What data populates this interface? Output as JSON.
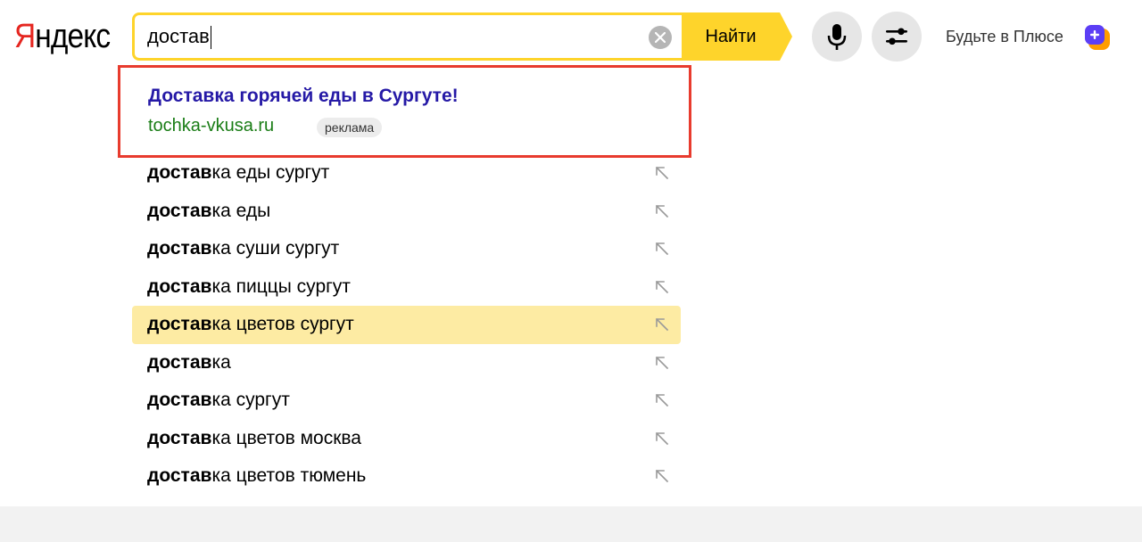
{
  "header": {
    "logo_first": "Я",
    "logo_rest": "ндекс",
    "find_label": "Найти",
    "plus_label": "Будьте в Плюсе"
  },
  "search": {
    "value": "достав"
  },
  "ad": {
    "title": "Доставка горячей еды в Сургуте!",
    "url": "tochka-vkusa.ru",
    "badge": "реклама"
  },
  "suggestions": [
    {
      "bold": "достав",
      "rest": "ка еды сургут",
      "highlighted": false
    },
    {
      "bold": "достав",
      "rest": "ка еды",
      "highlighted": false
    },
    {
      "bold": "достав",
      "rest": "ка суши сургут",
      "highlighted": false
    },
    {
      "bold": "достав",
      "rest": "ка пиццы сургут",
      "highlighted": false
    },
    {
      "bold": "достав",
      "rest": "ка цветов сургут",
      "highlighted": true
    },
    {
      "bold": "достав",
      "rest": "ка",
      "highlighted": false
    },
    {
      "bold": "достав",
      "rest": "ка сургут",
      "highlighted": false
    },
    {
      "bold": "достав",
      "rest": "ка цветов москва",
      "highlighted": false
    },
    {
      "bold": "достав",
      "rest": "ка цветов тюмень",
      "highlighted": false
    }
  ],
  "icons": {
    "clear": "close-icon",
    "mic": "microphone-icon",
    "filter": "settings-sliders-icon",
    "plus": "plus-badge-icon",
    "suggestion_arrow": "arrow-up-left-icon"
  },
  "colors": {
    "accent_yellow": "#fed42b",
    "logo_red": "#e52620",
    "ad_border": "#e83b2e",
    "ad_title": "#2519a6",
    "ad_url": "#1a7d16",
    "highlight": "#fdeba3"
  }
}
